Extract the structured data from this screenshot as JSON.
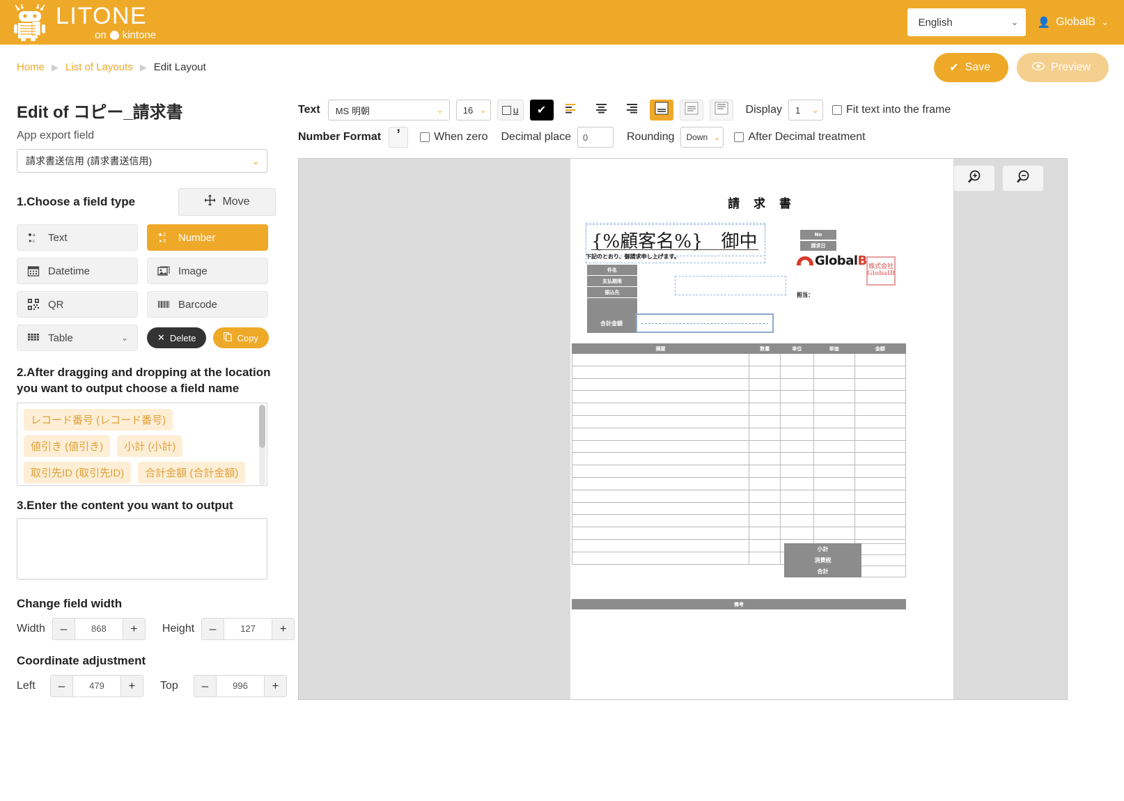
{
  "header": {
    "brand_main": "LITONE",
    "brand_on": "on",
    "brand_kintone": "kintone",
    "language": "English",
    "user": "GlobalB",
    "user_icon": "person-icon",
    "chevron_icon": "chevron-down-icon"
  },
  "breadcrumb": {
    "home": "Home",
    "list": "List of Layouts",
    "current": "Edit Layout",
    "sep": "▶"
  },
  "actions": {
    "save": "Save",
    "save_icon": "check-icon",
    "preview": "Preview",
    "preview_icon": "eye-icon"
  },
  "left": {
    "title": "Edit of コピー_請求書",
    "app_export_label": "App export field",
    "app_export_value": "請求書送信用 (請求書送信用)",
    "step1": "1.Choose a field type",
    "move": "Move",
    "move_icon": "move-cross-icon",
    "field_types": [
      {
        "label": "Text",
        "icon": "text-abc-icon",
        "active": false
      },
      {
        "label": "Number",
        "icon": "number-123-icon",
        "active": true
      },
      {
        "label": "Datetime",
        "icon": "calendar-icon",
        "active": false
      },
      {
        "label": "Image",
        "icon": "image-icon",
        "active": false
      },
      {
        "label": "QR",
        "icon": "qr-code-icon",
        "active": false
      },
      {
        "label": "Barcode",
        "icon": "barcode-icon",
        "active": false
      },
      {
        "label": "Table",
        "icon": "table-grid-icon",
        "active": false
      }
    ],
    "delete": "Delete",
    "delete_icon": "close-x-icon",
    "copy": "Copy",
    "copy_icon": "copy-icon",
    "step2": "2.After dragging and dropping at the location you want to output choose a field name",
    "field_chips": [
      "レコード番号 (レコード番号)",
      "値引き (値引き)",
      "小計 (小計)",
      "取引先ID (取引先ID)",
      "合計金額 (合計金額)"
    ],
    "step3": "3.Enter the content you want to output",
    "content_value": "",
    "content_placeholder": "",
    "change_width_header": "Change field width",
    "width_label": "Width",
    "width_value": "868",
    "height_label": "Height",
    "height_value": "127",
    "coord_header": "Coordinate adjustment",
    "left_label": "Left",
    "left_value": "479",
    "top_label": "Top",
    "top_value": "996",
    "minus": "–",
    "plus": "+"
  },
  "toolbar": {
    "text_label": "Text",
    "font_family": "MS 明朝",
    "font_size": "16",
    "underline_label": "u",
    "color_swatch": "#000000",
    "color_check_icon": "check-icon",
    "align_left_icon": "align-left-icon",
    "align_center_icon": "align-center-icon",
    "align_right_icon": "align-right-icon",
    "valign_bottom_icon": "vertical-align-bottom-icon",
    "valign_middle_icon": "vertical-align-middle-icon",
    "valign_top_icon": "vertical-align-top-icon",
    "display_label": "Display",
    "display_value": "1",
    "fit_text_label": "Fit text into the frame",
    "fit_text_checked": false,
    "number_format_label": "Number Format",
    "comma_glyph": "’",
    "when_zero_label": "When zero",
    "when_zero_checked": false,
    "decimal_place_label": "Decimal place",
    "decimal_place_value": "0",
    "rounding_label": "Rounding",
    "rounding_value": "Down",
    "after_decimal_label": "After Decimal treatment",
    "after_decimal_checked": false
  },
  "canvas": {
    "zoom_in_icon": "zoom-in-icon",
    "zoom_out_icon": "zoom-out-icon"
  },
  "document": {
    "title": "請 求 書",
    "customer_placeholder": "{%顧客名%}　御中",
    "description_line": "下記のとおり、御請求申し上げます。",
    "left_labels": [
      "件名",
      "支払期限",
      "振込先"
    ],
    "total_label": "合計金額",
    "no_labels": [
      "No",
      "請求日"
    ],
    "logo_text": "Global",
    "logo_b": "B",
    "stamp_line1": "株式会社",
    "stamp_line2": "GlobalB",
    "tanto": "担当：",
    "table_headers": [
      "摘要",
      "数量",
      "単位",
      "単価",
      "金額"
    ],
    "table_row_count": 17,
    "summary_rows": [
      "小計",
      "消費税",
      "合計"
    ],
    "remarks": "備考"
  }
}
